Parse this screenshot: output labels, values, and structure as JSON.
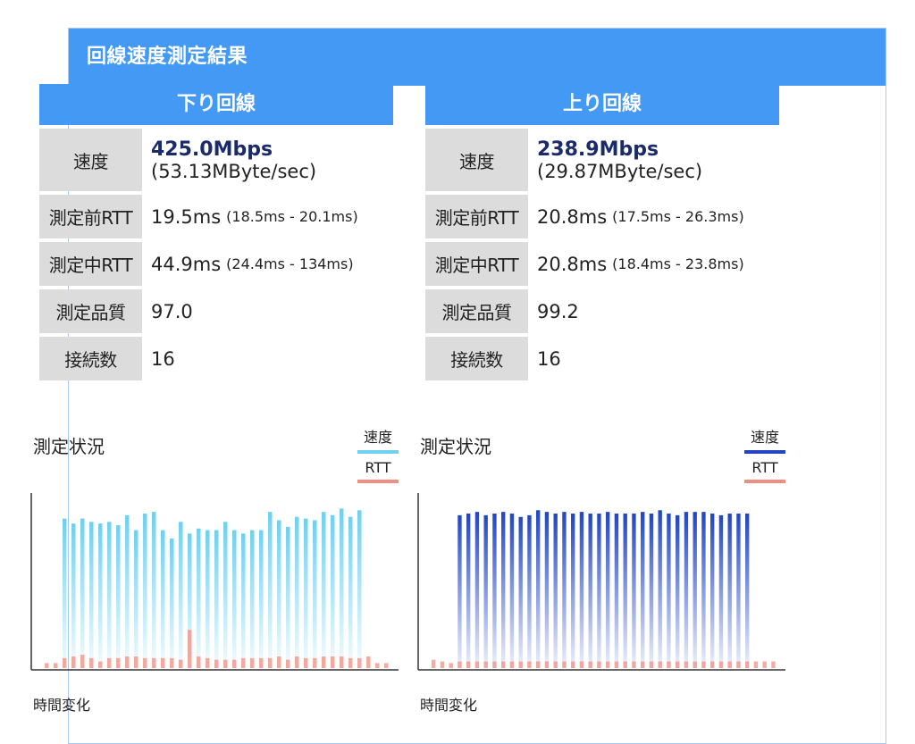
{
  "header": {
    "title": "回線速度測定結果"
  },
  "download": {
    "title": "下り回線",
    "speed_label": "速度",
    "speed_main": "425.0Mbps",
    "speed_sub": "(53.13MByte/sec)",
    "rtt_before_label": "測定前RTT",
    "rtt_before_value": "19.5ms",
    "rtt_before_range": "(18.5ms - 20.1ms)",
    "rtt_during_label": "測定中RTT",
    "rtt_during_value": "44.9ms",
    "rtt_during_range": "(24.4ms - 134ms)",
    "quality_label": "測定品質",
    "quality_value": "97.0",
    "connections_label": "接続数",
    "connections_value": "16"
  },
  "upload": {
    "title": "上り回線",
    "speed_label": "速度",
    "speed_main": "238.9Mbps",
    "speed_sub": "(29.87MByte/sec)",
    "rtt_before_label": "測定前RTT",
    "rtt_before_value": "20.8ms",
    "rtt_before_range": "(17.5ms - 26.3ms)",
    "rtt_during_label": "測定中RTT",
    "rtt_during_value": "20.8ms",
    "rtt_during_range": "(18.4ms - 23.8ms)",
    "quality_label": "測定品質",
    "quality_value": "99.2",
    "connections_label": "接続数",
    "connections_value": "16"
  },
  "colors": {
    "header_blue": "#4499f4",
    "label_gray": "#dcdcdc",
    "speed_text": "#1b2a6b",
    "down_speed": "#6fd0ef",
    "up_speed": "#2145c4",
    "rtt": "#f08f80"
  },
  "chart_data": [
    {
      "type": "bar",
      "title": "測定状況",
      "xlabel": "時間変化",
      "legend": [
        "速度",
        "RTT"
      ],
      "legend_placement": "top-right",
      "speed_color": "#6fd0ef",
      "rtt_color": "#f08f80",
      "speed": [
        0,
        0,
        0.9,
        0.87,
        0.9,
        0.88,
        0.87,
        0.88,
        0.86,
        0.92,
        0.83,
        0.93,
        0.94,
        0.83,
        0.78,
        0.88,
        0.81,
        0.84,
        0.83,
        0.83,
        0.88,
        0.83,
        0.81,
        0.83,
        0.83,
        0.94,
        0.89,
        0.85,
        0.91,
        0.9,
        0.89,
        0.94,
        0.92,
        0.96,
        0.91,
        0.95,
        0,
        0,
        0
      ],
      "rtt": [
        0.03,
        0.03,
        0.06,
        0.07,
        0.08,
        0.06,
        0.04,
        0.06,
        0.06,
        0.07,
        0.07,
        0.06,
        0.06,
        0.06,
        0.06,
        0.05,
        0.23,
        0.07,
        0.06,
        0.05,
        0.05,
        0.05,
        0.06,
        0.06,
        0.06,
        0.06,
        0.07,
        0.05,
        0.07,
        0.06,
        0.06,
        0.07,
        0.07,
        0.07,
        0.06,
        0.06,
        0.07,
        0.03,
        0.03
      ]
    },
    {
      "type": "bar",
      "title": "測定状況",
      "xlabel": "時間変化",
      "legend": [
        "速度",
        "RTT"
      ],
      "legend_placement": "top-right",
      "speed_color": "#2145c4",
      "rtt_color": "#f08f80",
      "speed": [
        0,
        0,
        0,
        0.92,
        0.93,
        0.94,
        0.92,
        0.93,
        0.94,
        0.93,
        0.91,
        0.92,
        0.95,
        0.94,
        0.93,
        0.94,
        0.93,
        0.94,
        0.93,
        0.93,
        0.94,
        0.93,
        0.93,
        0.93,
        0.94,
        0.93,
        0.95,
        0.93,
        0.92,
        0.94,
        0.94,
        0.94,
        0.93,
        0.92,
        0.93,
        0.93,
        0.93,
        0,
        0,
        0
      ],
      "rtt": [
        0.05,
        0.04,
        0.03,
        0.04,
        0.04,
        0.04,
        0.04,
        0.04,
        0.04,
        0.04,
        0.04,
        0.04,
        0.04,
        0.04,
        0.04,
        0.04,
        0.04,
        0.04,
        0.04,
        0.04,
        0.04,
        0.04,
        0.04,
        0.04,
        0.04,
        0.04,
        0.04,
        0.04,
        0.04,
        0.04,
        0.04,
        0.04,
        0.04,
        0.04,
        0.04,
        0.04,
        0.04,
        0.04,
        0.04,
        0.04
      ]
    }
  ]
}
